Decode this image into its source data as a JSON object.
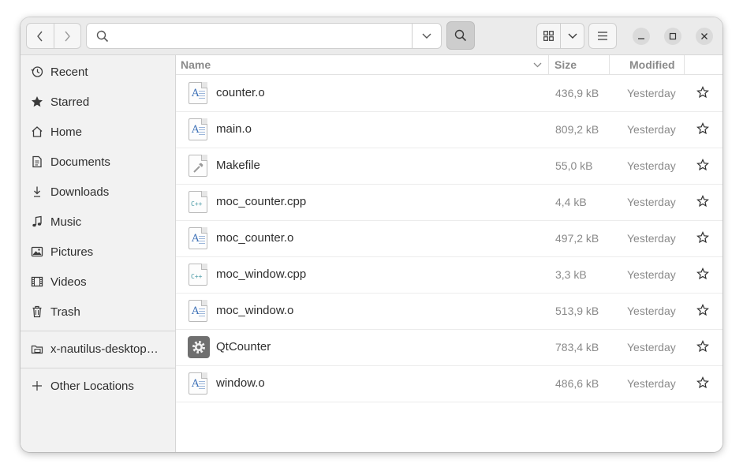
{
  "search": {
    "placeholder": "",
    "value": ""
  },
  "sidebar": {
    "items": [
      {
        "label": "Recent",
        "icon": "clock-icon"
      },
      {
        "label": "Starred",
        "icon": "star-icon"
      },
      {
        "label": "Home",
        "icon": "home-icon"
      },
      {
        "label": "Documents",
        "icon": "documents-icon"
      },
      {
        "label": "Downloads",
        "icon": "downloads-icon"
      },
      {
        "label": "Music",
        "icon": "music-icon"
      },
      {
        "label": "Pictures",
        "icon": "pictures-icon"
      },
      {
        "label": "Videos",
        "icon": "videos-icon"
      },
      {
        "label": "Trash",
        "icon": "trash-icon"
      }
    ],
    "mount": {
      "label": "x-nautilus-desktop…",
      "icon": "drive-icon"
    },
    "other": {
      "label": "Other Locations",
      "icon": "plus-icon"
    }
  },
  "columns": {
    "name": "Name",
    "size": "Size",
    "modified": "Modified"
  },
  "files": [
    {
      "name": "counter.o",
      "size": "436,9 kB",
      "modified": "Yesterday",
      "icon": "text-document-icon"
    },
    {
      "name": "main.o",
      "size": "809,2 kB",
      "modified": "Yesterday",
      "icon": "text-document-icon"
    },
    {
      "name": "Makefile",
      "size": "55,0 kB",
      "modified": "Yesterday",
      "icon": "makefile-icon"
    },
    {
      "name": "moc_counter.cpp",
      "size": "4,4 kB",
      "modified": "Yesterday",
      "icon": "cpp-source-icon"
    },
    {
      "name": "moc_counter.o",
      "size": "497,2 kB",
      "modified": "Yesterday",
      "icon": "text-document-icon"
    },
    {
      "name": "moc_window.cpp",
      "size": "3,3 kB",
      "modified": "Yesterday",
      "icon": "cpp-source-icon"
    },
    {
      "name": "moc_window.o",
      "size": "513,9 kB",
      "modified": "Yesterday",
      "icon": "text-document-icon"
    },
    {
      "name": "QtCounter",
      "size": "783,4 kB",
      "modified": "Yesterday",
      "icon": "executable-gear-icon"
    },
    {
      "name": "window.o",
      "size": "486,6 kB",
      "modified": "Yesterday",
      "icon": "text-document-icon"
    }
  ],
  "cpp_badge": "C++",
  "doc_glyph": "A"
}
